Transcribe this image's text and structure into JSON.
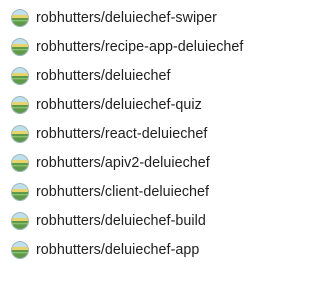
{
  "repos": [
    {
      "name": "robhutters/deluiechef-swiper",
      "icon": "user-avatar-icon"
    },
    {
      "name": "robhutters/recipe-app-deluiechef",
      "icon": "user-avatar-icon"
    },
    {
      "name": "robhutters/deluiechef",
      "icon": "user-avatar-icon"
    },
    {
      "name": "robhutters/deluiechef-quiz",
      "icon": "user-avatar-icon"
    },
    {
      "name": "robhutters/react-deluiechef",
      "icon": "user-avatar-icon"
    },
    {
      "name": "robhutters/apiv2-deluiechef",
      "icon": "user-avatar-icon"
    },
    {
      "name": "robhutters/client-deluiechef",
      "icon": "user-avatar-icon"
    },
    {
      "name": "robhutters/deluiechef-build",
      "icon": "user-avatar-icon"
    },
    {
      "name": "robhutters/deluiechef-app",
      "icon": "user-avatar-icon"
    }
  ],
  "colors": {
    "text": "#1f1f1f",
    "avatar_sky": "#bfe0ea",
    "avatar_band": "#e8d46a",
    "avatar_ground": "#5e9a4a"
  }
}
